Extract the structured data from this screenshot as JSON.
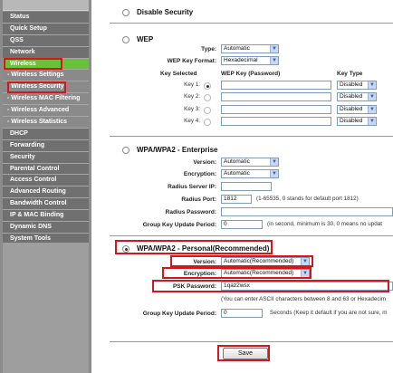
{
  "sidebar": {
    "items": [
      {
        "label": "Status",
        "type": "main"
      },
      {
        "label": "Quick Setup",
        "type": "main"
      },
      {
        "label": "QSS",
        "type": "main"
      },
      {
        "label": "Network",
        "type": "main"
      },
      {
        "label": "Wireless",
        "type": "main-active"
      },
      {
        "label": "- Wireless Settings",
        "type": "sub"
      },
      {
        "label": "- Wireless Security",
        "type": "sub-selected"
      },
      {
        "label": "- Wireless MAC Filtering",
        "type": "sub"
      },
      {
        "label": "- Wireless Advanced",
        "type": "sub"
      },
      {
        "label": "- Wireless Statistics",
        "type": "sub"
      },
      {
        "label": "DHCP",
        "type": "main"
      },
      {
        "label": "Forwarding",
        "type": "main"
      },
      {
        "label": "Security",
        "type": "main"
      },
      {
        "label": "Parental Control",
        "type": "main"
      },
      {
        "label": "Access Control",
        "type": "main"
      },
      {
        "label": "Advanced Routing",
        "type": "main"
      },
      {
        "label": "Bandwidth Control",
        "type": "main"
      },
      {
        "label": "IP & MAC Binding",
        "type": "main"
      },
      {
        "label": "Dynamic DNS",
        "type": "main"
      },
      {
        "label": "System Tools",
        "type": "main"
      }
    ]
  },
  "disable": {
    "label": "Disable Security"
  },
  "wep": {
    "label": "WEP",
    "type_label": "Type:",
    "type_value": "Automatic",
    "format_label": "WEP Key Format:",
    "format_value": "Hexadecimal",
    "col_key_selected": "Key Selected",
    "col_key": "WEP Key (Password)",
    "col_type": "Key Type",
    "keys": [
      {
        "label": "Key 1:",
        "type": "Disabled"
      },
      {
        "label": "Key 2:",
        "type": "Disabled"
      },
      {
        "label": "Key 3:",
        "type": "Disabled"
      },
      {
        "label": "Key 4:",
        "type": "Disabled"
      }
    ]
  },
  "ent": {
    "label": "WPA/WPA2 - Enterprise",
    "version_label": "Version:",
    "version_value": "Automatic",
    "enc_label": "Encryption:",
    "enc_value": "Automatic",
    "radius_ip_label": "Radius Server IP:",
    "radius_port_label": "Radius Port:",
    "radius_port_value": "1812",
    "radius_port_note": "(1-65535, 0 stands for default port 1812)",
    "radius_pw_label": "Radius Password:",
    "gk_label": "Group Key Update Period:",
    "gk_value": "0",
    "gk_note": "(in second, minimum is 30, 0 means no updat"
  },
  "personal": {
    "label": "WPA/WPA2 - Personal(Recommended)",
    "version_label": "Version:",
    "version_value": "Automatic(Recommended)",
    "enc_label": "Encryption:",
    "enc_value": "Automatic(Recommended)",
    "psk_label": "PSK Password:",
    "psk_value": "1qaz2wsx",
    "psk_note": "(You can enter ASCII characters between 8 and 63 or Hexadecim",
    "gk_label": "Group Key Update Period:",
    "gk_value": "0",
    "gk_note": "Seconds (Keep it default if you are not sure, m"
  },
  "save_label": "Save"
}
